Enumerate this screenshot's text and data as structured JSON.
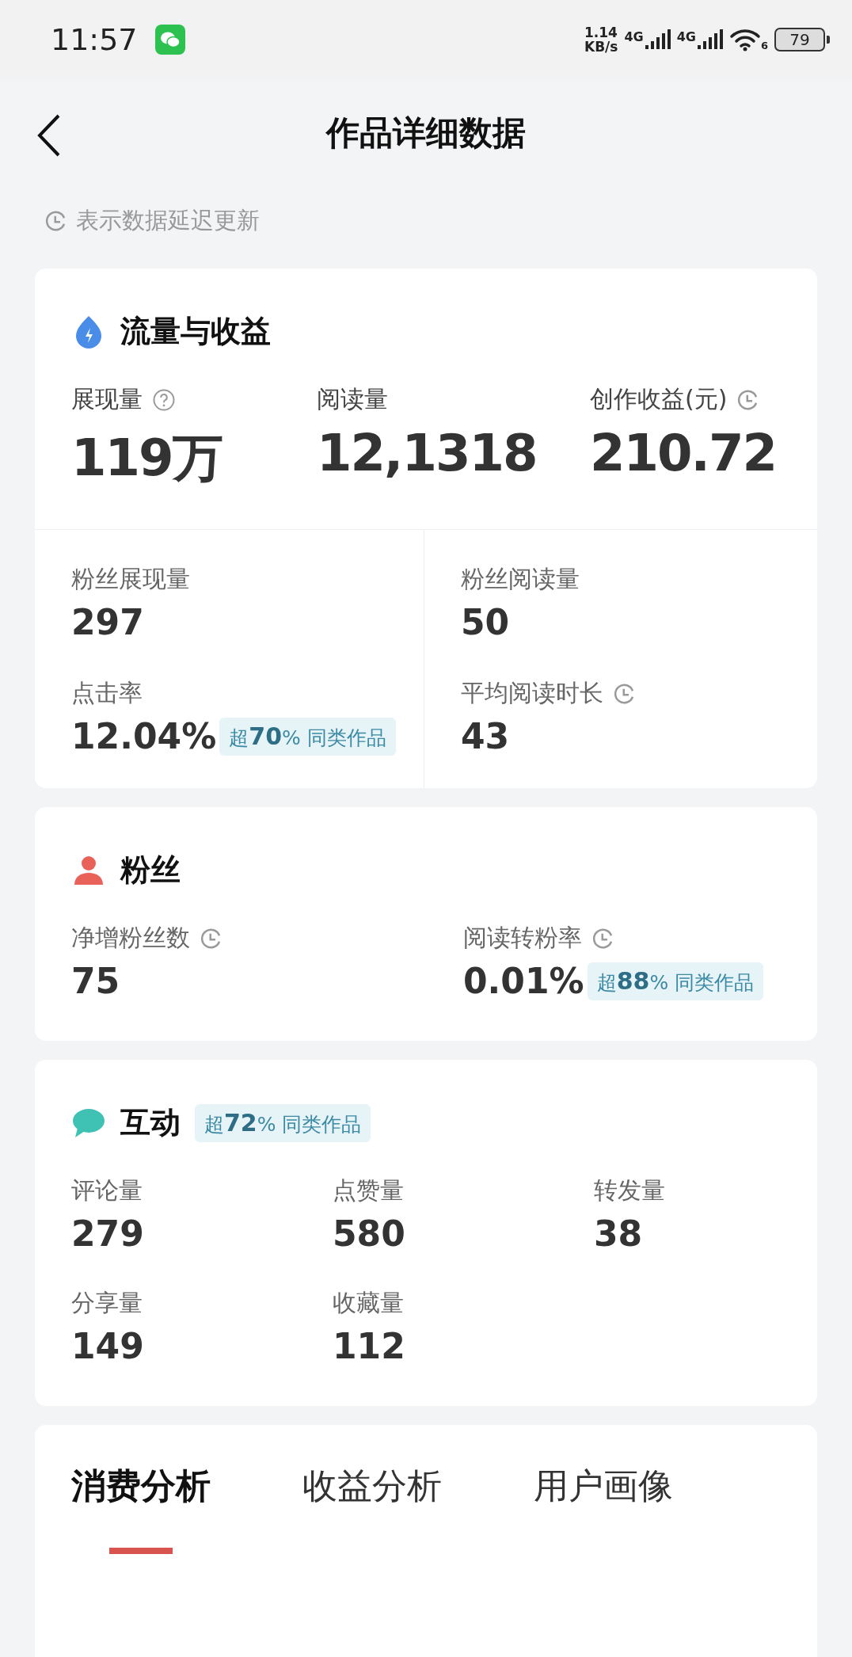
{
  "status_bar": {
    "time": "11:57",
    "speed": "1.14",
    "speed_unit": "KB/s",
    "networks": [
      "4G",
      "4G"
    ],
    "wifi": "6",
    "battery": "79"
  },
  "header": {
    "title": "作品详细数据"
  },
  "notice": "表示数据延迟更新",
  "traffic": {
    "title": "流量与收益",
    "main_metrics": [
      {
        "label": "展现量",
        "help": true,
        "value": "119万"
      },
      {
        "label": "阅读量",
        "value": "12,1318"
      },
      {
        "label": "创作收益(元)",
        "delayed": true,
        "value": "210.72"
      }
    ],
    "left_metrics": [
      {
        "label": "粉丝展现量",
        "value": "297"
      },
      {
        "label": "点击率",
        "value": "12.04%",
        "badge": "超**70**% 同类作品"
      }
    ],
    "right_metrics": [
      {
        "label": "粉丝阅读量",
        "value": "50"
      },
      {
        "label": "平均阅读时长",
        "delayed": true,
        "value": "43"
      }
    ]
  },
  "fans": {
    "title": "粉丝",
    "metrics": [
      {
        "label": "净增粉丝数",
        "delayed": true,
        "value": "75"
      },
      {
        "label": "阅读转粉率",
        "delayed": true,
        "value": "0.01%",
        "badge": "超**88**% 同类作品"
      }
    ]
  },
  "interaction": {
    "title": "互动",
    "badge": "超**72**% 同类作品",
    "metrics": [
      {
        "label": "评论量",
        "value": "279"
      },
      {
        "label": "点赞量",
        "value": "580"
      },
      {
        "label": "转发量",
        "value": "38"
      },
      {
        "label": "分享量",
        "value": "149"
      },
      {
        "label": "收藏量",
        "value": "112"
      }
    ]
  },
  "tabs": [
    {
      "label": "消费分析",
      "selected": true
    },
    {
      "label": "收益分析",
      "selected": false
    },
    {
      "label": "用户画像",
      "selected": false
    }
  ]
}
